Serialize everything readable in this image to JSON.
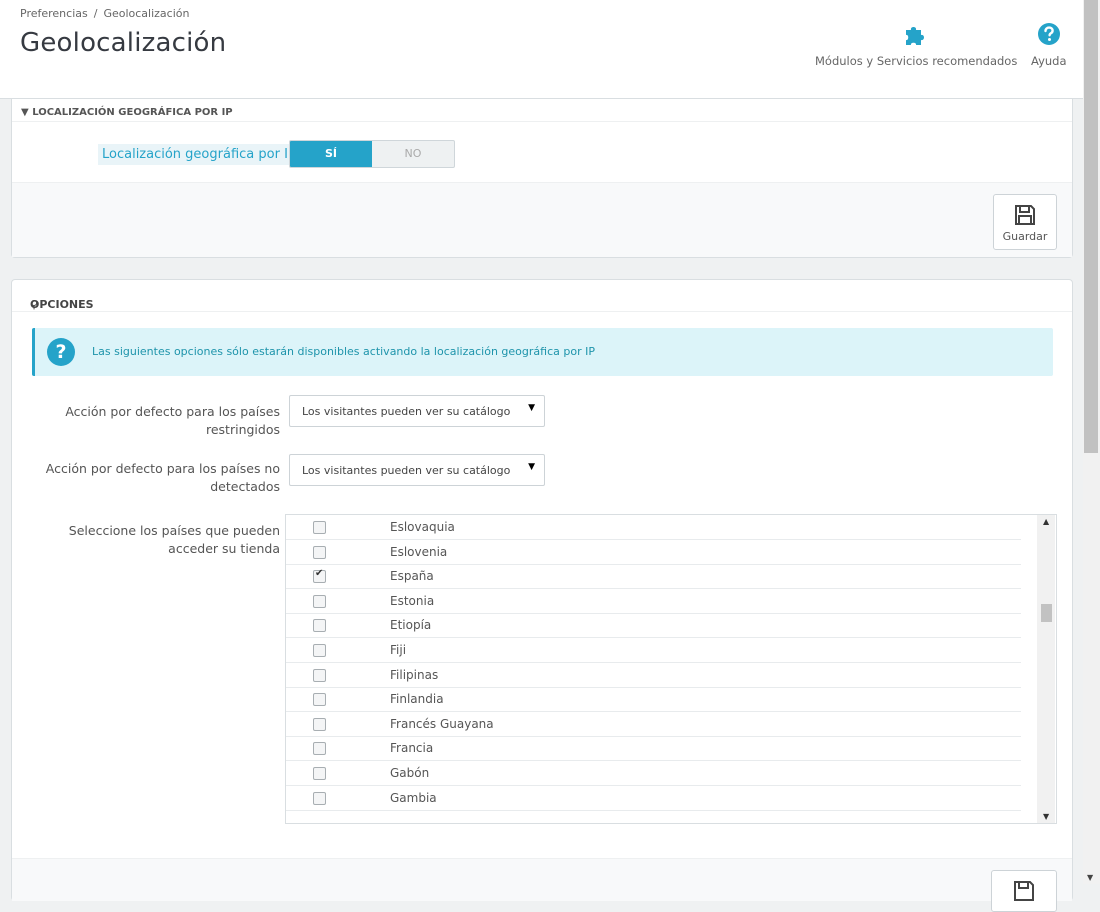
{
  "header": {
    "breadcrumb": [
      "Preferencias",
      "Geolocalización"
    ],
    "breadcrumb_sep": "/",
    "title": "Geolocalización",
    "toolbar": {
      "modules_label": "Módulos y Servicios recomendados",
      "help_label": "Ayuda"
    }
  },
  "geo_panel": {
    "heading": "LOCALIZACIÓN GEOGRÁFICA POR IP",
    "field_label": "Localización geográfica por IP",
    "toggle_yes": "SÍ",
    "toggle_no": "NO",
    "toggle_value": "SÍ",
    "save_label": "Guardar"
  },
  "options_panel": {
    "heading": "OPCIONES",
    "info_text": "Las siguientes opciones sólo estarán disponibles activando la localización geográfica por IP",
    "restricted_label_1": "Acción por defecto para los países",
    "restricted_label_2": "restringidos",
    "restricted_value": "Los visitantes pueden ver su catálogo",
    "undetected_label_1": "Acción por defecto para los países no",
    "undetected_label_2": "detectados",
    "undetected_value": "Los visitantes pueden ver su catálogo",
    "countries_label_1": "Seleccione los países que pueden",
    "countries_label_2": "acceder su tienda",
    "countries": [
      {
        "name": "Eslovaquia",
        "checked": false
      },
      {
        "name": "Eslovenia",
        "checked": false
      },
      {
        "name": "España",
        "checked": true
      },
      {
        "name": "Estonia",
        "checked": false
      },
      {
        "name": "Etiopía",
        "checked": false
      },
      {
        "name": "Fiji",
        "checked": false
      },
      {
        "name": "Filipinas",
        "checked": false
      },
      {
        "name": "Finlandia",
        "checked": false
      },
      {
        "name": "Francés Guayana",
        "checked": false
      },
      {
        "name": "Francia",
        "checked": false
      },
      {
        "name": "Gabón",
        "checked": false
      },
      {
        "name": "Gambia",
        "checked": false
      }
    ]
  },
  "colors": {
    "accent": "#25a3c9",
    "info_bg": "#dcf4f9",
    "page_bg": "#eff1f2"
  }
}
